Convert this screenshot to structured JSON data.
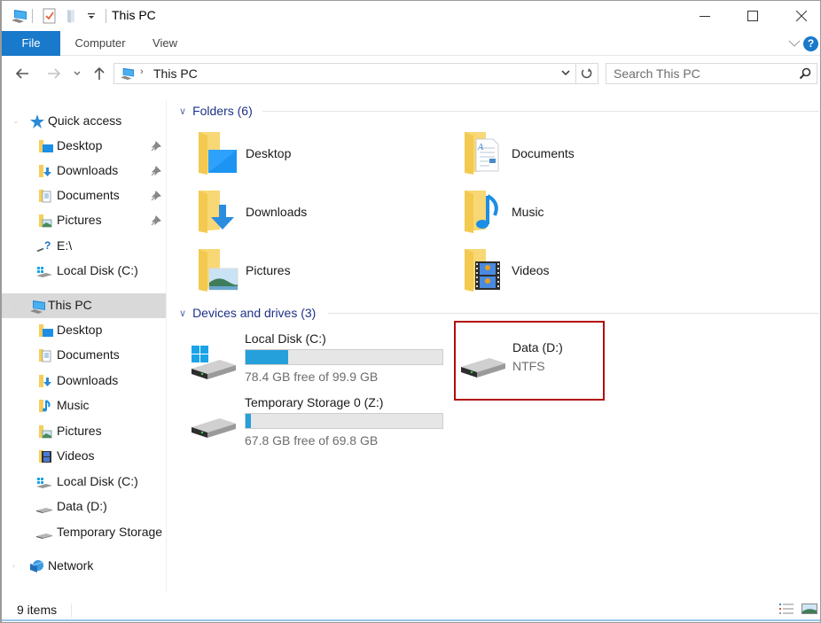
{
  "window": {
    "title": "This PC",
    "controls": {
      "minimize": "minimize",
      "maximize": "maximize",
      "close": "close"
    }
  },
  "quick_access_toolbar": {
    "icons": [
      "this-pc-icon",
      "properties-icon",
      "new-folder-icon",
      "customize-dropdown-icon"
    ]
  },
  "ribbon": {
    "tabs": [
      {
        "label": "File",
        "active": true
      },
      {
        "label": "Computer",
        "active": false
      },
      {
        "label": "View",
        "active": false
      }
    ],
    "help_label": "?"
  },
  "navigation": {
    "breadcrumb": [
      "This PC"
    ],
    "search_placeholder": "Search This PC",
    "search_value": ""
  },
  "sidebar": {
    "items": [
      {
        "label": "Quick access",
        "icon": "star-icon",
        "level": 0,
        "pinned": false
      },
      {
        "label": "Desktop",
        "icon": "desktop-folder-icon",
        "level": 1,
        "pinned": true
      },
      {
        "label": "Downloads",
        "icon": "downloads-folder-icon",
        "level": 1,
        "pinned": true
      },
      {
        "label": "Documents",
        "icon": "documents-folder-icon",
        "level": 1,
        "pinned": true
      },
      {
        "label": "Pictures",
        "icon": "pictures-folder-icon",
        "level": 1,
        "pinned": true
      },
      {
        "label": "E:\\",
        "icon": "unknown-drive-icon",
        "level": 1,
        "pinned": false
      },
      {
        "label": "Local Disk (C:)",
        "icon": "windows-drive-icon",
        "level": 1,
        "pinned": false
      },
      {
        "label": "This PC",
        "icon": "this-pc-icon",
        "level": 0,
        "selected": true
      },
      {
        "label": "Desktop",
        "icon": "desktop-folder-icon",
        "level": 1
      },
      {
        "label": "Documents",
        "icon": "documents-folder-icon",
        "level": 1
      },
      {
        "label": "Downloads",
        "icon": "downloads-folder-icon",
        "level": 1
      },
      {
        "label": "Music",
        "icon": "music-folder-icon",
        "level": 1
      },
      {
        "label": "Pictures",
        "icon": "pictures-folder-icon",
        "level": 1
      },
      {
        "label": "Videos",
        "icon": "videos-folder-icon",
        "level": 1
      },
      {
        "label": "Local Disk (C:)",
        "icon": "windows-drive-icon",
        "level": 1
      },
      {
        "label": "Data (D:)",
        "icon": "drive-icon",
        "level": 1
      },
      {
        "label": "Temporary Storage (Z:)",
        "icon": "drive-icon",
        "level": 1
      },
      {
        "label": "Network",
        "icon": "network-icon",
        "level": 0
      }
    ]
  },
  "content": {
    "folders_group": {
      "title": "Folders (6)",
      "items": [
        {
          "name": "Desktop",
          "icon": "desktop-folder-icon"
        },
        {
          "name": "Documents",
          "icon": "documents-folder-icon"
        },
        {
          "name": "Downloads",
          "icon": "downloads-folder-icon"
        },
        {
          "name": "Music",
          "icon": "music-folder-icon"
        },
        {
          "name": "Pictures",
          "icon": "pictures-folder-icon"
        },
        {
          "name": "Videos",
          "icon": "videos-folder-icon"
        }
      ]
    },
    "drives_group": {
      "title": "Devices and drives (3)",
      "items": [
        {
          "name": "Local Disk (C:)",
          "free_text": "78.4 GB free of 99.9 GB",
          "used_fraction": 0.215,
          "icon": "windows-drive-icon"
        },
        {
          "name": "Temporary Storage 0 (Z:)",
          "free_text": "67.8 GB free of 69.8 GB",
          "used_fraction": 0.029,
          "icon": "drive-icon"
        },
        {
          "name": "Data (D:)",
          "filesystem": "NTFS",
          "icon": "drive-icon",
          "highlighted": true
        }
      ]
    }
  },
  "statusbar": {
    "item_count": "9 items",
    "views": [
      "details-view",
      "large-icons-view"
    ]
  },
  "colors": {
    "accent": "#1979ca",
    "group_header": "#1e3287",
    "usage_bar": "#26a0da",
    "highlight_border": "#b30b0b",
    "selected_nav": "#d9d9d9"
  }
}
